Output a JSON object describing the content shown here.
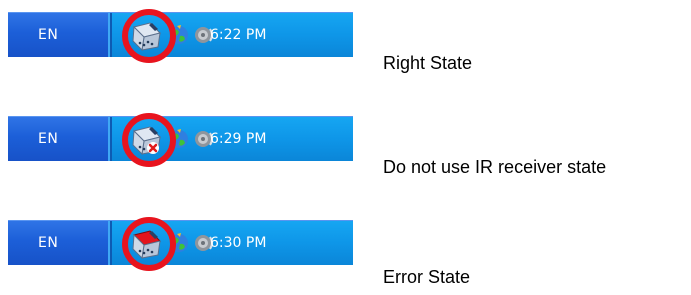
{
  "rows": [
    {
      "language": "EN",
      "time": "6:22 PM",
      "caption": "Right State",
      "ir_state": "normal"
    },
    {
      "language": "EN",
      "time": "6:29 PM",
      "caption": "Do not use IR receiver state",
      "ir_state": "disabled"
    },
    {
      "language": "EN",
      "time": "6:30 PM",
      "caption": "Error State",
      "ir_state": "error"
    }
  ],
  "colors": {
    "taskbar_blue": "#1c5fd8",
    "tray_blue": "#0e96e8",
    "highlight_red": "#e8141e",
    "disabled_badge": "#e11b1b",
    "error_red": "#e3141c"
  },
  "icons": [
    "ir-receiver-icon",
    "network-globe-icon",
    "speaker-icon"
  ]
}
